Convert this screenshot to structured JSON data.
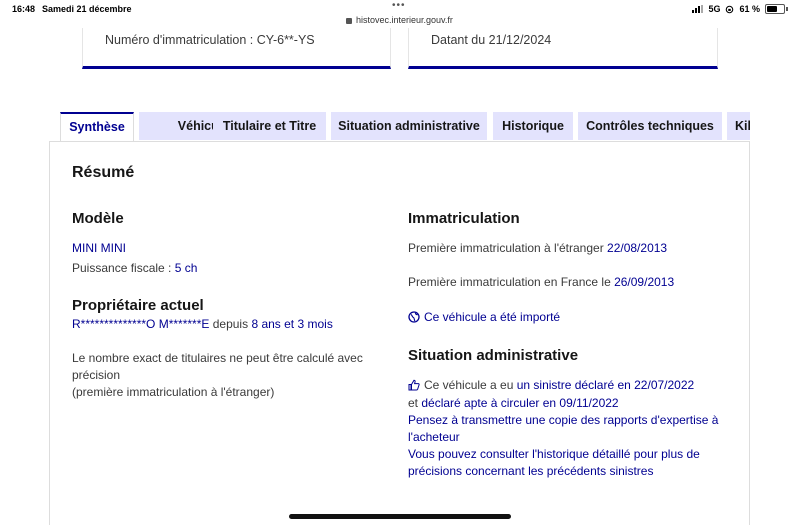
{
  "status_bar": {
    "time": "16:48",
    "date": "Samedi 21 décembre",
    "dots": "•••",
    "url": "histovec.interieur.gouv.fr",
    "network": "5G",
    "battery": "61 %"
  },
  "cards": {
    "registration": "Numéro d'immatriculation : CY-6**-YS",
    "date": "Datant du 21/12/2024"
  },
  "tabs": [
    {
      "label": "Synthèse",
      "active": true
    },
    {
      "label": "Véhicule"
    },
    {
      "label": "Titulaire et Titre"
    },
    {
      "label": "Situation administrative"
    },
    {
      "label": "Historique"
    },
    {
      "label": "Contrôles techniques"
    },
    {
      "label": "Kilo"
    }
  ],
  "summary": {
    "title": "Résumé",
    "model": {
      "heading": "Modèle",
      "name": "MINI MINI",
      "fiscal_power_label": "Puissance fiscale : ",
      "fiscal_power_value": "5 ch"
    },
    "owner": {
      "heading": "Propriétaire actuel",
      "name": "R**************O M*******E",
      "since_label": " depuis ",
      "since_value": "8 ans et 3 mois",
      "note_line1": "Le nombre exact de titulaires ne peut être calculé avec",
      "note_line2": "précision",
      "note_line3": "(première immatriculation à l'étranger)"
    },
    "registration": {
      "heading": "Immatriculation",
      "foreign_label": "Première immatriculation à l'étranger ",
      "foreign_date": "22/08/2013",
      "france_label": "Première immatriculation en France le ",
      "france_date": "26/09/2013",
      "imported": "Ce véhicule a été importé"
    },
    "admin": {
      "heading": "Situation administrative",
      "line1_prefix": "Ce véhicule a eu ",
      "line1_link": "un sinistre déclaré en 22/07/2022",
      "line2_prefix": "et ",
      "line2_link": "déclaré apte à circuler en 09/11/2022",
      "advice1_line1": "Pensez à transmettre une copie des rapports d'expertise à",
      "advice1_line2": "l'acheteur",
      "advice2_line1": "Vous pouvez consulter l'historique détaillé pour plus de",
      "advice2_line2": "précisions concernant les précédents sinistres"
    }
  },
  "colors": {
    "accent": "#000091",
    "tab_bg": "#e3e3fd",
    "text": "#161616"
  }
}
